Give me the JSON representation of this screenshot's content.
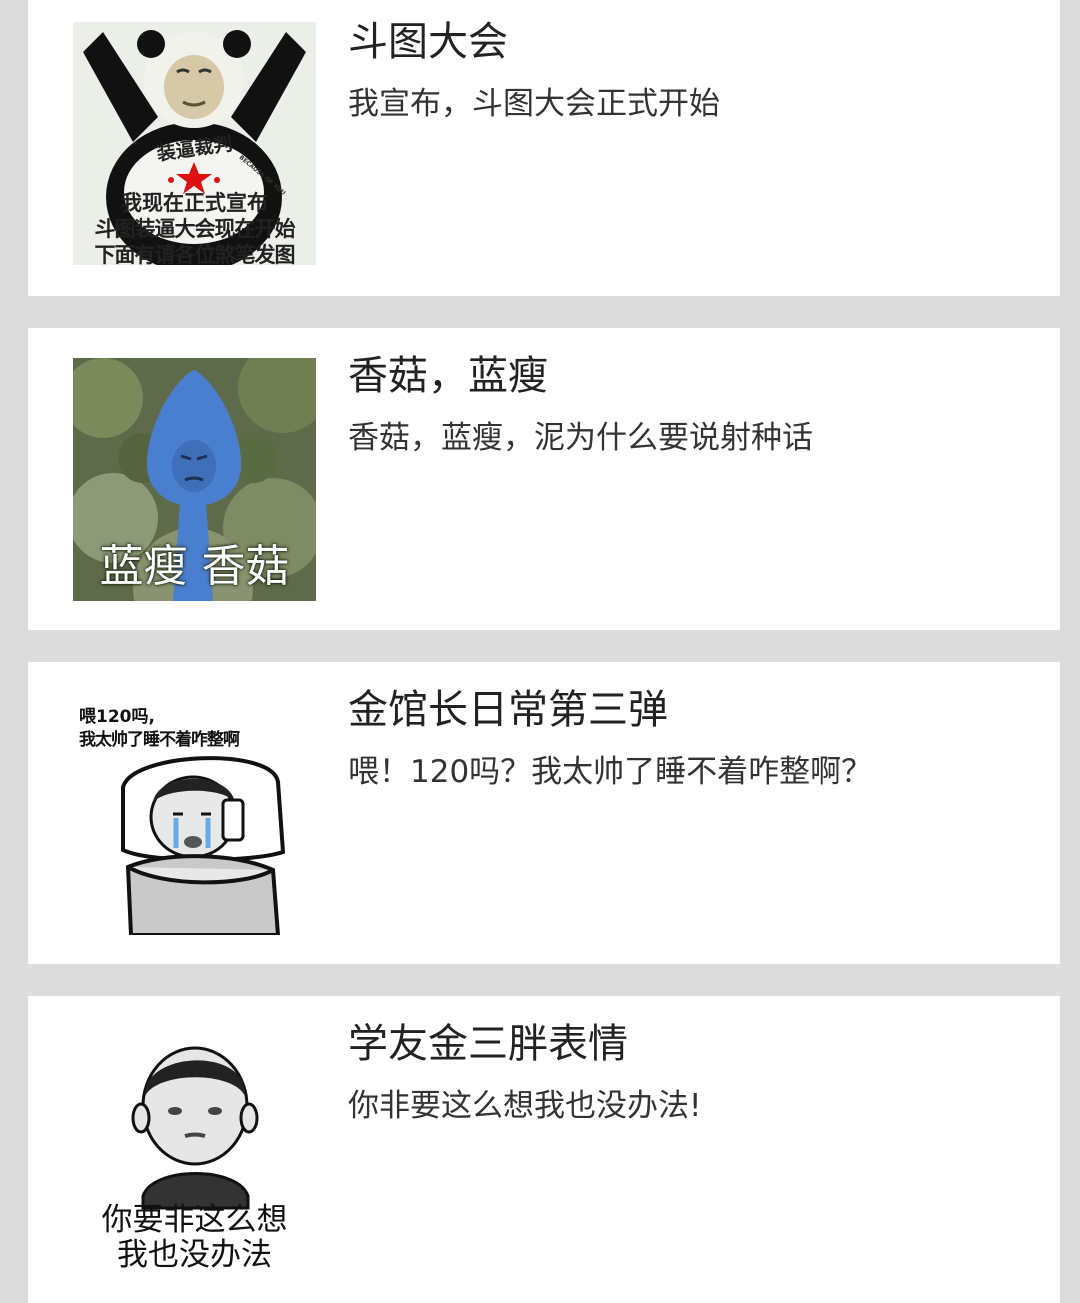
{
  "items": [
    {
      "title": "斗图大会",
      "desc": "我宣布，斗图大会正式开始",
      "image_caption": {
        "badge": "装逼裁判",
        "tiny": "BECAUSE OF YOU",
        "line1": "我现在正式宣布",
        "line2": "斗图装逼大会现在开始",
        "line3": "下面有请各位煞笔发图"
      }
    },
    {
      "title": "香菇，蓝瘦",
      "desc": "香菇，蓝瘦，泥为什么要说射种话",
      "image_caption": {
        "text": "蓝瘦 香菇"
      }
    },
    {
      "title": "金馆长日常第三弹",
      "desc": "喂！120吗？我太帅了睡不着咋整啊？",
      "image_caption": {
        "line1": "喂120吗,",
        "line2": "我太帅了睡不着咋整啊"
      }
    },
    {
      "title": "学友金三胖表情",
      "desc": "你非要这么想我也没办法!",
      "image_caption": {
        "line1": "你要非这么想",
        "line2": "我也没办法"
      }
    }
  ],
  "colors": {
    "page_background": "#dcdcdc",
    "card_background": "#ffffff",
    "title": "#222222",
    "desc": "#333333",
    "mushroom_blue": "#4a7fcf"
  }
}
